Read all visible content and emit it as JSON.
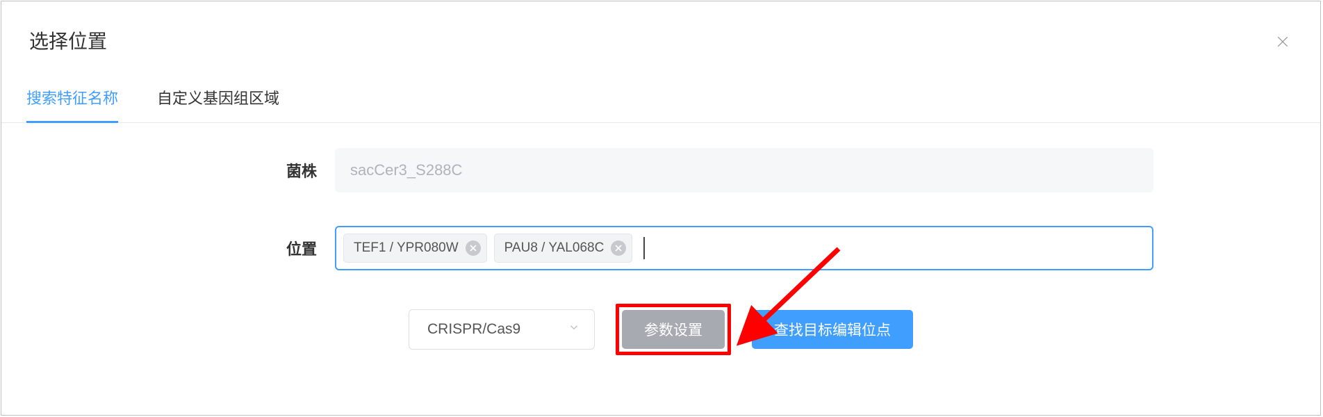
{
  "dialog": {
    "title": "选择位置"
  },
  "tabs": {
    "items": [
      {
        "label": "搜索特征名称",
        "active": true
      },
      {
        "label": "自定义基因组区域",
        "active": false
      }
    ]
  },
  "form": {
    "strain_label": "菌株",
    "strain_value": "sacCer3_S288C",
    "location_label": "位置",
    "tags": [
      "TEF1 / YPR080W",
      "PAU8 / YAL068C"
    ]
  },
  "controls": {
    "method_select": "CRISPR/Cas9",
    "param_button": "参数设置",
    "search_button": "查找目标编辑位点"
  },
  "icons": {
    "close": "close-icon",
    "chevron_down": "chevron-down-icon",
    "tag_remove": "tag-remove-icon"
  },
  "annotation": {
    "type": "arrow",
    "color": "#ff0000",
    "target": "param-settings-button"
  }
}
